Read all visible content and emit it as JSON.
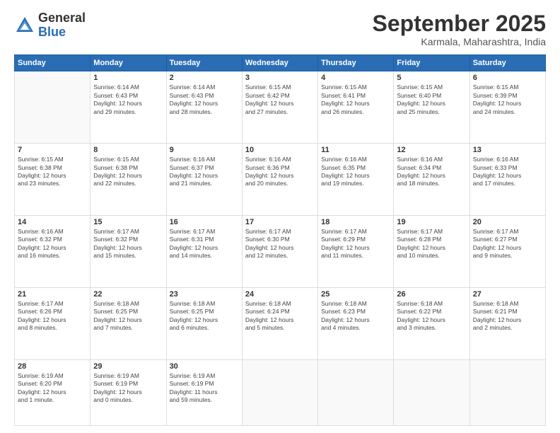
{
  "logo": {
    "general": "General",
    "blue": "Blue"
  },
  "title": "September 2025",
  "location": "Karmala, Maharashtra, India",
  "days_header": [
    "Sunday",
    "Monday",
    "Tuesday",
    "Wednesday",
    "Thursday",
    "Friday",
    "Saturday"
  ],
  "weeks": [
    [
      {
        "day": "",
        "info": ""
      },
      {
        "day": "1",
        "info": "Sunrise: 6:14 AM\nSunset: 6:43 PM\nDaylight: 12 hours\nand 29 minutes."
      },
      {
        "day": "2",
        "info": "Sunrise: 6:14 AM\nSunset: 6:43 PM\nDaylight: 12 hours\nand 28 minutes."
      },
      {
        "day": "3",
        "info": "Sunrise: 6:15 AM\nSunset: 6:42 PM\nDaylight: 12 hours\nand 27 minutes."
      },
      {
        "day": "4",
        "info": "Sunrise: 6:15 AM\nSunset: 6:41 PM\nDaylight: 12 hours\nand 26 minutes."
      },
      {
        "day": "5",
        "info": "Sunrise: 6:15 AM\nSunset: 6:40 PM\nDaylight: 12 hours\nand 25 minutes."
      },
      {
        "day": "6",
        "info": "Sunrise: 6:15 AM\nSunset: 6:39 PM\nDaylight: 12 hours\nand 24 minutes."
      }
    ],
    [
      {
        "day": "7",
        "info": "Sunrise: 6:15 AM\nSunset: 6:38 PM\nDaylight: 12 hours\nand 23 minutes."
      },
      {
        "day": "8",
        "info": "Sunrise: 6:15 AM\nSunset: 6:38 PM\nDaylight: 12 hours\nand 22 minutes."
      },
      {
        "day": "9",
        "info": "Sunrise: 6:16 AM\nSunset: 6:37 PM\nDaylight: 12 hours\nand 21 minutes."
      },
      {
        "day": "10",
        "info": "Sunrise: 6:16 AM\nSunset: 6:36 PM\nDaylight: 12 hours\nand 20 minutes."
      },
      {
        "day": "11",
        "info": "Sunrise: 6:16 AM\nSunset: 6:35 PM\nDaylight: 12 hours\nand 19 minutes."
      },
      {
        "day": "12",
        "info": "Sunrise: 6:16 AM\nSunset: 6:34 PM\nDaylight: 12 hours\nand 18 minutes."
      },
      {
        "day": "13",
        "info": "Sunrise: 6:16 AM\nSunset: 6:33 PM\nDaylight: 12 hours\nand 17 minutes."
      }
    ],
    [
      {
        "day": "14",
        "info": "Sunrise: 6:16 AM\nSunset: 6:32 PM\nDaylight: 12 hours\nand 16 minutes."
      },
      {
        "day": "15",
        "info": "Sunrise: 6:17 AM\nSunset: 6:32 PM\nDaylight: 12 hours\nand 15 minutes."
      },
      {
        "day": "16",
        "info": "Sunrise: 6:17 AM\nSunset: 6:31 PM\nDaylight: 12 hours\nand 14 minutes."
      },
      {
        "day": "17",
        "info": "Sunrise: 6:17 AM\nSunset: 6:30 PM\nDaylight: 12 hours\nand 12 minutes."
      },
      {
        "day": "18",
        "info": "Sunrise: 6:17 AM\nSunset: 6:29 PM\nDaylight: 12 hours\nand 11 minutes."
      },
      {
        "day": "19",
        "info": "Sunrise: 6:17 AM\nSunset: 6:28 PM\nDaylight: 12 hours\nand 10 minutes."
      },
      {
        "day": "20",
        "info": "Sunrise: 6:17 AM\nSunset: 6:27 PM\nDaylight: 12 hours\nand 9 minutes."
      }
    ],
    [
      {
        "day": "21",
        "info": "Sunrise: 6:17 AM\nSunset: 6:26 PM\nDaylight: 12 hours\nand 8 minutes."
      },
      {
        "day": "22",
        "info": "Sunrise: 6:18 AM\nSunset: 6:25 PM\nDaylight: 12 hours\nand 7 minutes."
      },
      {
        "day": "23",
        "info": "Sunrise: 6:18 AM\nSunset: 6:25 PM\nDaylight: 12 hours\nand 6 minutes."
      },
      {
        "day": "24",
        "info": "Sunrise: 6:18 AM\nSunset: 6:24 PM\nDaylight: 12 hours\nand 5 minutes."
      },
      {
        "day": "25",
        "info": "Sunrise: 6:18 AM\nSunset: 6:23 PM\nDaylight: 12 hours\nand 4 minutes."
      },
      {
        "day": "26",
        "info": "Sunrise: 6:18 AM\nSunset: 6:22 PM\nDaylight: 12 hours\nand 3 minutes."
      },
      {
        "day": "27",
        "info": "Sunrise: 6:18 AM\nSunset: 6:21 PM\nDaylight: 12 hours\nand 2 minutes."
      }
    ],
    [
      {
        "day": "28",
        "info": "Sunrise: 6:19 AM\nSunset: 6:20 PM\nDaylight: 12 hours\nand 1 minute."
      },
      {
        "day": "29",
        "info": "Sunrise: 6:19 AM\nSunset: 6:19 PM\nDaylight: 12 hours\nand 0 minutes."
      },
      {
        "day": "30",
        "info": "Sunrise: 6:19 AM\nSunset: 6:19 PM\nDaylight: 11 hours\nand 59 minutes."
      },
      {
        "day": "",
        "info": ""
      },
      {
        "day": "",
        "info": ""
      },
      {
        "day": "",
        "info": ""
      },
      {
        "day": "",
        "info": ""
      }
    ]
  ]
}
